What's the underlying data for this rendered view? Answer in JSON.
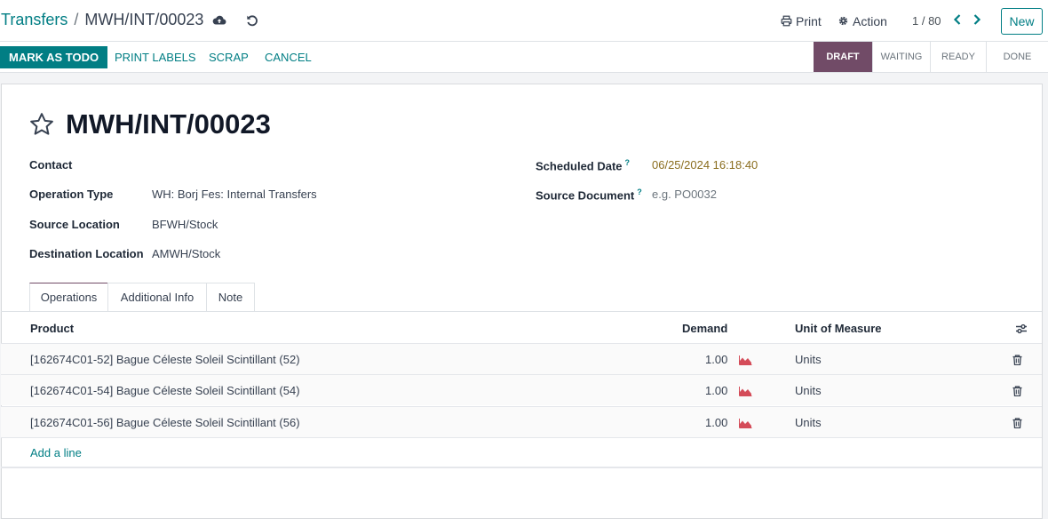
{
  "breadcrumb": {
    "parent": "Transfers",
    "separator": "/",
    "current": "MWH/INT/00023"
  },
  "top": {
    "print_label": "Print",
    "action_label": "Action",
    "pager": "1 / 80",
    "new_label": "New"
  },
  "actions": {
    "primary": "MARK AS TODO",
    "print_labels": "PRINT LABELS",
    "scrap": "SCRAP",
    "cancel": "CANCEL"
  },
  "status": {
    "stages": [
      "DRAFT",
      "WAITING",
      "READY",
      "DONE"
    ],
    "active": "DRAFT"
  },
  "record": {
    "title": "MWH/INT/00023",
    "fields_left": [
      {
        "label": "Contact",
        "value": ""
      },
      {
        "label": "Operation Type",
        "value": "WH: Borj Fes: Internal Transfers"
      },
      {
        "label": "Source Location",
        "value": "BFWH/Stock"
      },
      {
        "label": "Destination Location",
        "value": "AMWH/Stock"
      }
    ],
    "fields_right": [
      {
        "label": "Scheduled Date",
        "help": "?",
        "value": "06/25/2024 16:18:40"
      },
      {
        "label": "Source Document",
        "help": "?",
        "placeholder": "e.g. PO0032"
      }
    ]
  },
  "tabs": [
    "Operations",
    "Additional Info",
    "Note"
  ],
  "table": {
    "columns": {
      "product": "Product",
      "demand": "Demand",
      "uom": "Unit of Measure"
    },
    "rows": [
      {
        "product": "[162674C01-52] Bague Céleste Soleil Scintillant (52)",
        "demand": "1.00",
        "uom": "Units"
      },
      {
        "product": "[162674C01-54] Bague Céleste Soleil Scintillant (54)",
        "demand": "1.00",
        "uom": "Units"
      },
      {
        "product": "[162674C01-56] Bague Céleste Soleil Scintillant (56)",
        "demand": "1.00",
        "uom": "Units"
      }
    ],
    "add_line": "Add a line"
  },
  "colors": {
    "brand": "#017e84",
    "status_active": "#714b67",
    "date_text": "#8a6d1e",
    "forecast_icon": "#d44c59"
  },
  "icons": [
    "cloud-upload-icon",
    "undo-icon",
    "printer-icon",
    "gear-icon",
    "chevron-left-icon",
    "chevron-right-icon",
    "star-icon",
    "forecast-chart-icon",
    "trash-icon",
    "optional-columns-icon"
  ]
}
